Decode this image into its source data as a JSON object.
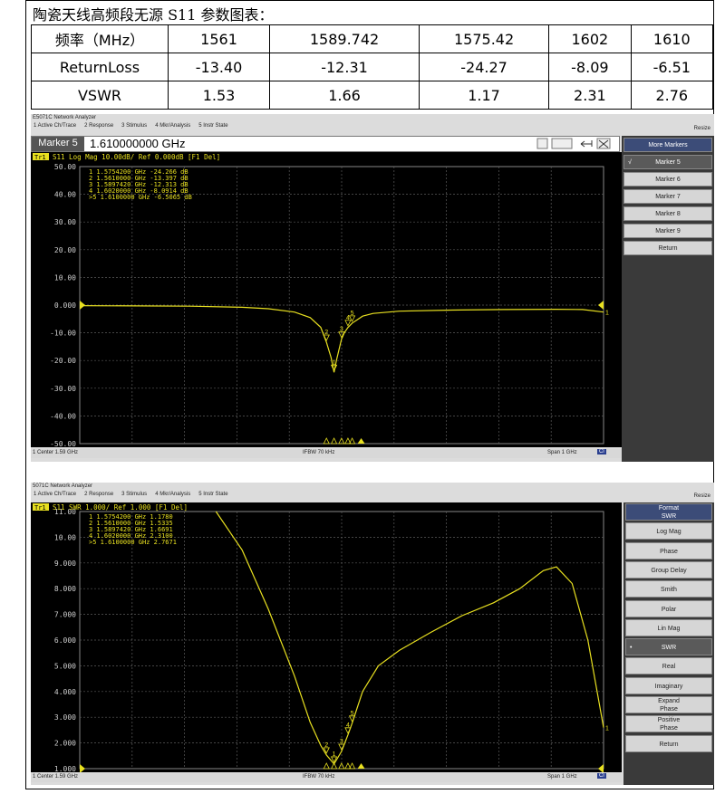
{
  "document": {
    "title": "陶瓷天线高频段无源 S11 参数图表：",
    "table": {
      "header": [
        "频率（MHz）",
        "1561",
        "1589.742",
        "1575.42",
        "1602",
        "1610"
      ],
      "rows": [
        [
          "ReturnLoss",
          "-13.40",
          "-12.31",
          "-24.27",
          "-8.09",
          "-6.51"
        ],
        [
          "VSWR",
          "1.53",
          "1.66",
          "1.17",
          "2.31",
          "2.76"
        ]
      ]
    }
  },
  "analyzer1": {
    "title": "E5071C Network Analyzer",
    "menu": [
      "1 Active Ch/Trace",
      "2 Response",
      "3 Stimulus",
      "4 Mkr/Analysis",
      "5 Instr State"
    ],
    "resize": "Resize",
    "marker_entry_label": "Marker 5",
    "marker_entry_value": "1.610000000 GHz",
    "trace_label": "Tr1",
    "trace_header": "S11 Log Mag 10.00dB/ Ref 0.000dB [F1 Del]",
    "marker_rows": [
      "1  1.5754200 GHz -24.266 dB",
      "2  1.5610000 GHz -13.397 dB",
      "3  1.5897420 GHz -12.313 dB",
      "4  1.6020000 GHz  -8.0914 dB",
      ">5  1.6100000 GHz  -6.5065 dB"
    ],
    "y_ticks": [
      "50.00",
      "40.00",
      "30.00",
      "20.00",
      "10.00",
      "0.000",
      "-10.00",
      "-20.00",
      "-30.00",
      "-40.00",
      "-50.00"
    ],
    "softkeys": [
      "More Markers",
      "Marker 5",
      "Marker 6",
      "Marker 7",
      "Marker 8",
      "Marker 9",
      "Return"
    ],
    "status_left": "1  Center 1.59 GHz",
    "status_mid": "IFBW 70 kHz",
    "status_right": "Span 1 GHz",
    "cal_badge": "Cl"
  },
  "analyzer2": {
    "title": "5071C Network Analyzer",
    "menu": [
      "1 Active Ch/Trace",
      "2 Response",
      "3 Stimulus",
      "4 Mkr/Analysis",
      "5 Instr State"
    ],
    "resize": "Resize",
    "trace_label": "Tr1",
    "trace_header": "S11 SWR 1.000/ Ref 1.000 [F1 Del]",
    "marker_rows": [
      "1  1.5754200 GHz  1.1780",
      "2  1.5610000 GHz  1.5335",
      "3  1.5897420 GHz  1.6691",
      "4  1.6020000 GHz  2.3100",
      ">5  1.6100000 GHz  2.7671"
    ],
    "y_ticks": [
      "11.00",
      "10.00",
      "9.000",
      "8.000",
      "7.000",
      "6.000",
      "5.000",
      "4.000",
      "3.000",
      "2.000",
      "1.000"
    ],
    "softkeys": [
      "Format\nSWR",
      "Log Mag",
      "Phase",
      "Group Delay",
      "Smith",
      "Polar",
      "Lin Mag",
      "SWR",
      "Real",
      "Imaginary",
      "Expand\nPhase",
      "Positive\nPhase",
      "Return"
    ],
    "status_left": "1  Center 1.59 GHz",
    "status_mid": "IFBW 70 kHz",
    "status_right": "Span 1 GHz",
    "cal_badge": "Cl"
  },
  "chart_data": [
    {
      "type": "line",
      "title": "S11 Log Mag 10.00dB/ Ref 0.000dB [F1 Del]",
      "xlabel": "",
      "ylabel": "",
      "ylim": [
        -50,
        50
      ],
      "x_range_ghz": [
        1.09,
        2.09
      ],
      "grid": true,
      "series": [
        {
          "name": "S11",
          "color": "#e8e020",
          "x": [
            1.09,
            1.2,
            1.3,
            1.4,
            1.45,
            1.5,
            1.53,
            1.55,
            1.561,
            1.57,
            1.5754,
            1.58,
            1.5897,
            1.595,
            1.602,
            1.61,
            1.63,
            1.65,
            1.7,
            1.8,
            1.9,
            2.0,
            2.05,
            2.09
          ],
          "y": [
            -0.2,
            -0.3,
            -0.4,
            -0.8,
            -1.3,
            -2.5,
            -4.5,
            -8.0,
            -13.4,
            -19.0,
            -24.27,
            -20.0,
            -12.31,
            -10.0,
            -8.09,
            -6.51,
            -4.0,
            -3.0,
            -2.2,
            -1.8,
            -1.6,
            -1.5,
            -1.6,
            -2.5
          ]
        }
      ],
      "markers": [
        {
          "id": "1",
          "x": 1.57542,
          "y": -24.266
        },
        {
          "id": "2",
          "x": 1.561,
          "y": -13.397
        },
        {
          "id": "3",
          "x": 1.589742,
          "y": -12.313
        },
        {
          "id": "4",
          "x": 1.602,
          "y": -8.0914
        },
        {
          "id": "5",
          "x": 1.61,
          "y": -6.5065
        }
      ]
    },
    {
      "type": "line",
      "title": "S11 SWR 1.000/ Ref 1.000 [F1 Del]",
      "xlabel": "",
      "ylabel": "",
      "ylim": [
        1,
        11
      ],
      "x_range_ghz": [
        1.09,
        2.09
      ],
      "grid": true,
      "series": [
        {
          "name": "S11",
          "color": "#e8e020",
          "x": [
            1.35,
            1.4,
            1.45,
            1.5,
            1.53,
            1.55,
            1.561,
            1.5754,
            1.5897,
            1.602,
            1.61,
            1.63,
            1.66,
            1.7,
            1.76,
            1.82,
            1.88,
            1.93,
            1.975,
            2.0,
            2.03,
            2.06,
            2.09
          ],
          "y": [
            11,
            9.5,
            7.2,
            4.6,
            2.8,
            1.9,
            1.53,
            1.18,
            1.67,
            2.31,
            2.77,
            4.0,
            5.0,
            5.6,
            6.3,
            6.95,
            7.45,
            8.0,
            8.7,
            8.85,
            8.2,
            6.0,
            2.6
          ]
        }
      ],
      "markers": [
        {
          "id": "1",
          "x": 1.57542,
          "y": 1.178
        },
        {
          "id": "2",
          "x": 1.561,
          "y": 1.5335
        },
        {
          "id": "3",
          "x": 1.589742,
          "y": 1.6691
        },
        {
          "id": "4",
          "x": 1.602,
          "y": 2.31
        },
        {
          "id": "5",
          "x": 1.61,
          "y": 2.7671
        }
      ]
    }
  ]
}
